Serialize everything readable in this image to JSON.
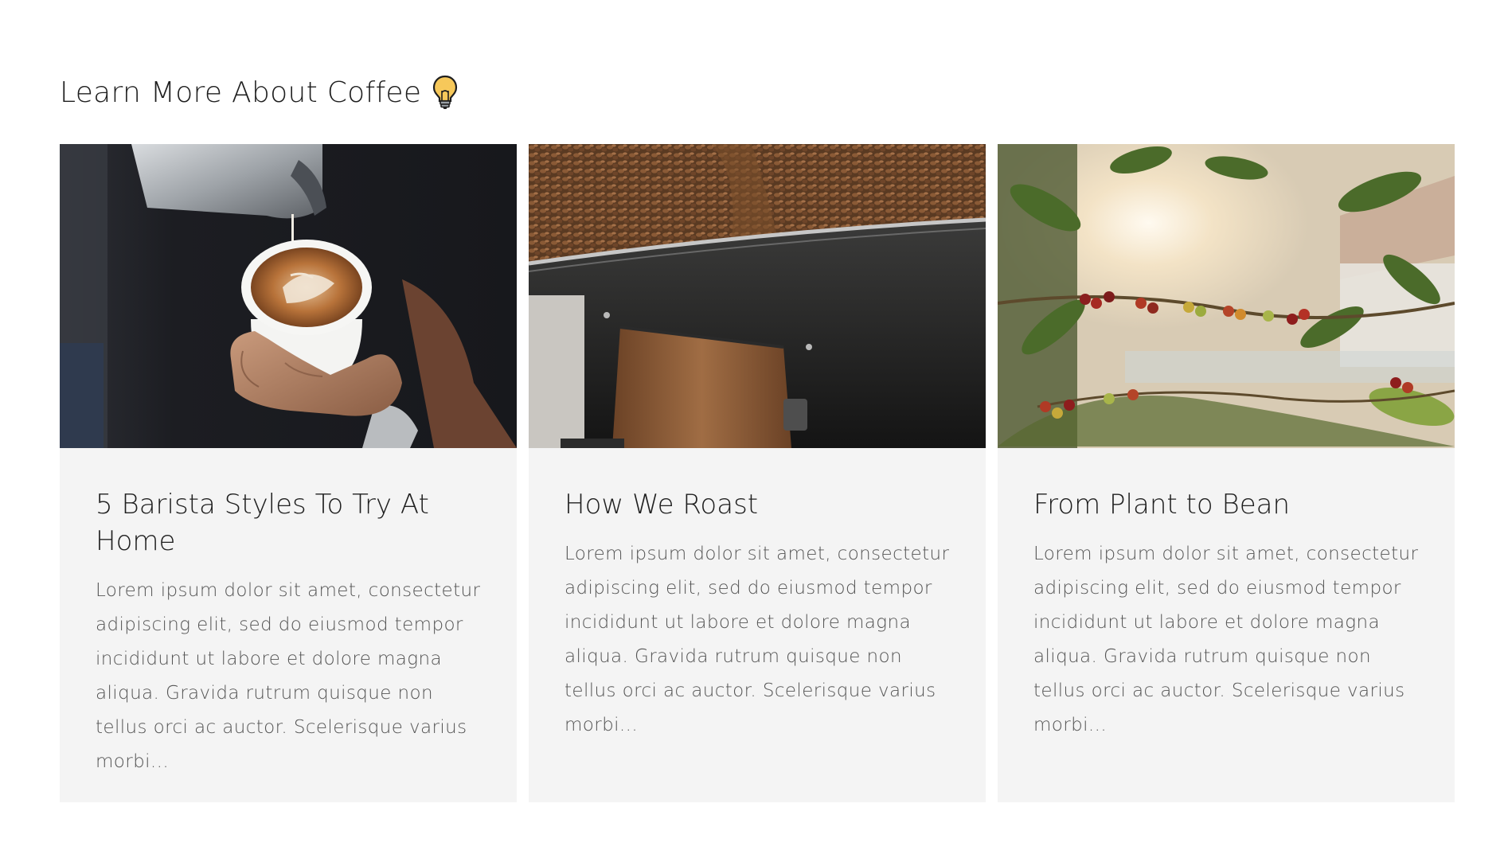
{
  "section": {
    "title": "Learn More About Coffee",
    "title_icon": "lightbulb-icon"
  },
  "cards": [
    {
      "image_alt": "latte-art-pour-image",
      "title": "5 Barista Styles To Try At Home",
      "excerpt": "Lorem ipsum dolor sit amet, consectetur adipiscing elit, sed do eiusmod tempor incididunt ut labore et dolore magna aliqua. Gravida rutrum quisque non tellus orci ac auctor. Scelerisque varius morbi..."
    },
    {
      "image_alt": "coffee-roaster-image",
      "title": "How We Roast",
      "excerpt": "Lorem ipsum dolor sit amet, consectetur adipiscing elit, sed do eiusmod tempor incididunt ut labore et dolore magna aliqua. Gravida rutrum quisque non tellus orci ac auctor. Scelerisque varius morbi..."
    },
    {
      "image_alt": "coffee-plant-cherries-image",
      "title": "From Plant to Bean",
      "excerpt": "Lorem ipsum dolor sit amet, consectetur adipiscing elit, sed do eiusmod tempor incididunt ut labore et dolore magna aliqua. Gravida rutrum quisque non tellus orci ac auctor. Scelerisque varius morbi..."
    }
  ],
  "colors": {
    "card_background": "#f4f4f4",
    "heading_text": "#1f1f1f",
    "body_text": "#555555",
    "bulb_yellow": "#f6c85a"
  }
}
